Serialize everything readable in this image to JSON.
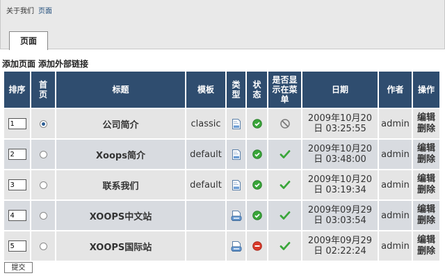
{
  "breadcrumb": {
    "section": "关于我们",
    "current": "页面"
  },
  "tab": {
    "label": "页面"
  },
  "actions": {
    "add_page": "添加页面",
    "add_link": "添加外部链接"
  },
  "columns": {
    "order": "排序",
    "home": "首页",
    "title": "标题",
    "template": "模板",
    "type": "类型",
    "status": "状态",
    "menu": "是否显示在菜单",
    "date": "日期",
    "author": "作者",
    "ops": "操作"
  },
  "rows": [
    {
      "order": "1",
      "home": true,
      "title": "公司简介",
      "template": "classic",
      "type": "page",
      "status": "ok",
      "menu": "no",
      "date1": "2009年10月20",
      "date2": "日 03:25:55",
      "author": "admin",
      "edit": "编辑",
      "delete": "删除"
    },
    {
      "order": "2",
      "home": false,
      "title": "Xoops简介",
      "template": "default",
      "type": "page",
      "status": "ok",
      "menu": "yes",
      "date1": "2009年10月20",
      "date2": "日 03:48:00",
      "author": "admin",
      "edit": "编辑",
      "delete": "删除"
    },
    {
      "order": "3",
      "home": false,
      "title": "联系我们",
      "template": "default",
      "type": "page",
      "status": "ok",
      "menu": "yes",
      "date1": "2009年10月20",
      "date2": "日 03:19:34",
      "author": "admin",
      "edit": "编辑",
      "delete": "删除"
    },
    {
      "order": "4",
      "home": false,
      "title": "XOOPS中文站",
      "template": "",
      "type": "link",
      "status": "ok",
      "menu": "yes",
      "date1": "2009年09月29",
      "date2": "日 03:03:54",
      "author": "admin",
      "edit": "编辑",
      "delete": "删除"
    },
    {
      "order": "5",
      "home": false,
      "title": "XOOPS国际站",
      "template": "",
      "type": "link",
      "status": "off",
      "menu": "yes",
      "date1": "2009年09月29",
      "date2": "日 02:22:24",
      "author": "admin",
      "edit": "编辑",
      "delete": "删除"
    }
  ],
  "submit": {
    "label": "提交"
  },
  "colors": {
    "header_bg": "#2f4d6f",
    "row_bg": "#e5e5e5",
    "row_alt_bg": "#d8dbe0",
    "ok_green": "#3aa63a",
    "off_red": "#d93a2a"
  }
}
